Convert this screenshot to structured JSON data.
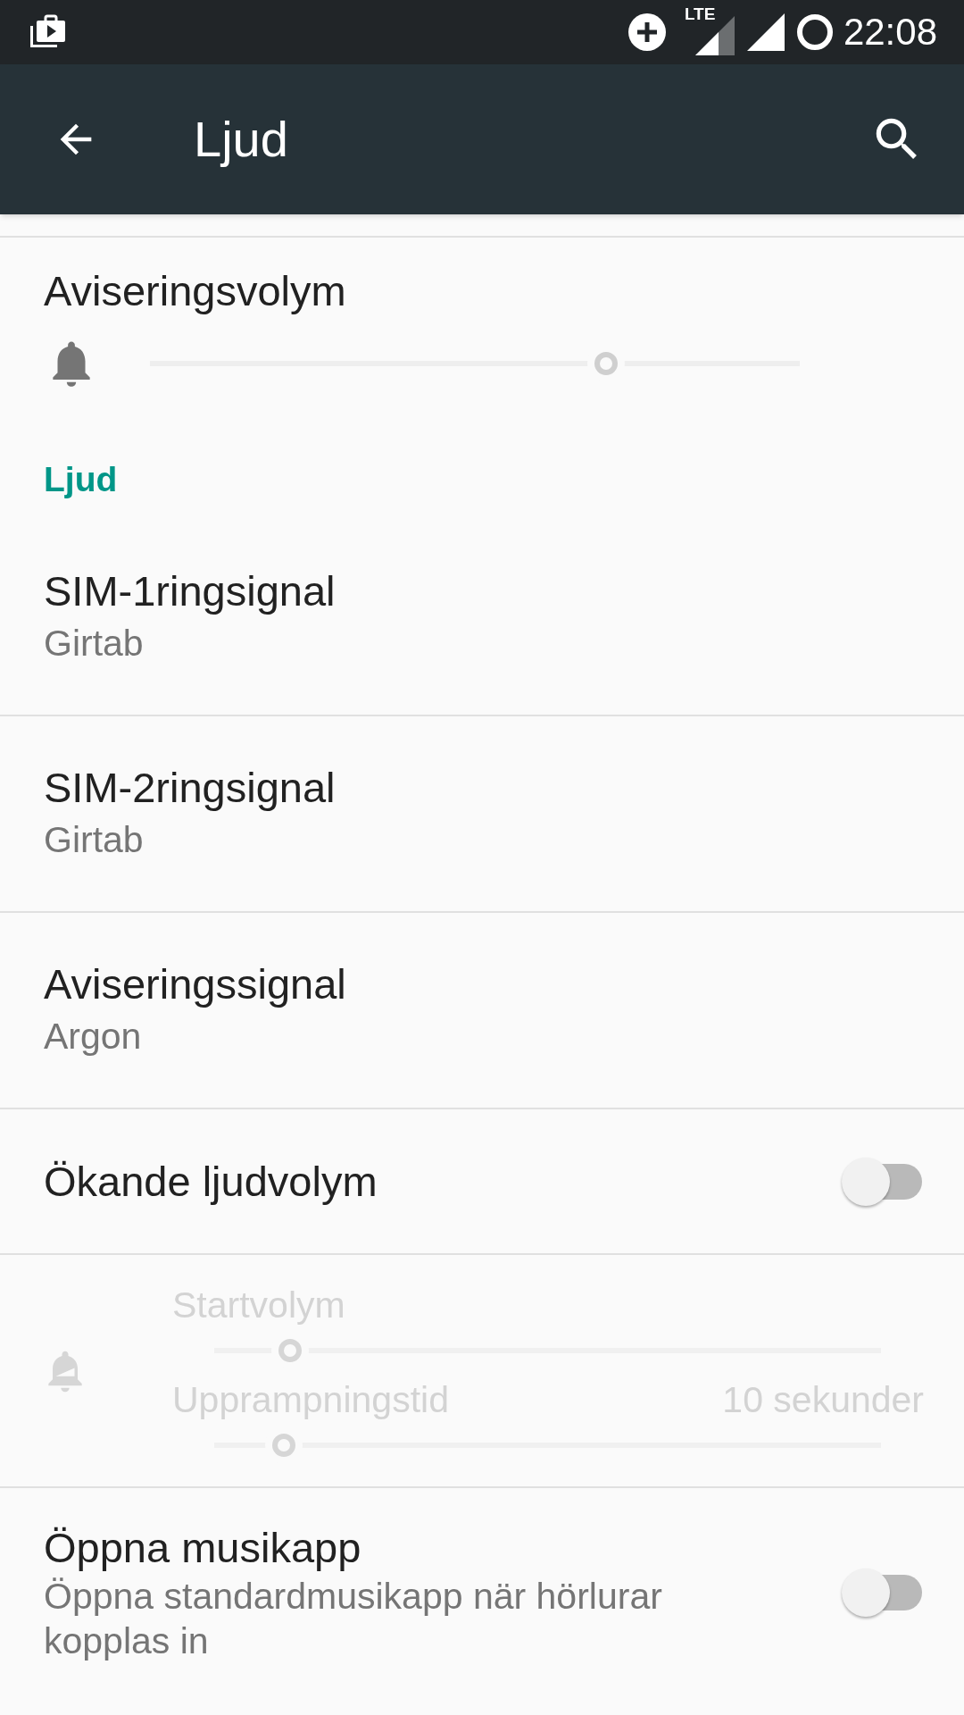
{
  "status_bar": {
    "time": "22:08",
    "lte_label": "LTE"
  },
  "toolbar": {
    "title": "Ljud"
  },
  "volume": {
    "title": "Aviseringsvolym",
    "level": 0.71
  },
  "section_header": "Ljud",
  "items": [
    {
      "kind": "text",
      "title": "SIM-1ringsignal",
      "subtitle": "Girtab"
    },
    {
      "kind": "text",
      "title": "SIM-2ringsignal",
      "subtitle": "Girtab"
    },
    {
      "kind": "text",
      "title": "Aviseringssignal",
      "subtitle": "Argon"
    },
    {
      "kind": "toggle",
      "title": "Ökande ljudvolym",
      "on": false
    },
    {
      "kind": "ramp",
      "disabled": true,
      "sliders": [
        {
          "label": "Startvolym",
          "level": 0.1
        },
        {
          "label": "Upprampningstid",
          "value": "10 sekunder",
          "level": 0.09
        }
      ]
    },
    {
      "kind": "toggle",
      "title": "Öppna musikapp",
      "subtitle": "Öppna standardmusikapp när hörlurar kopplas in",
      "on": false
    }
  ]
}
